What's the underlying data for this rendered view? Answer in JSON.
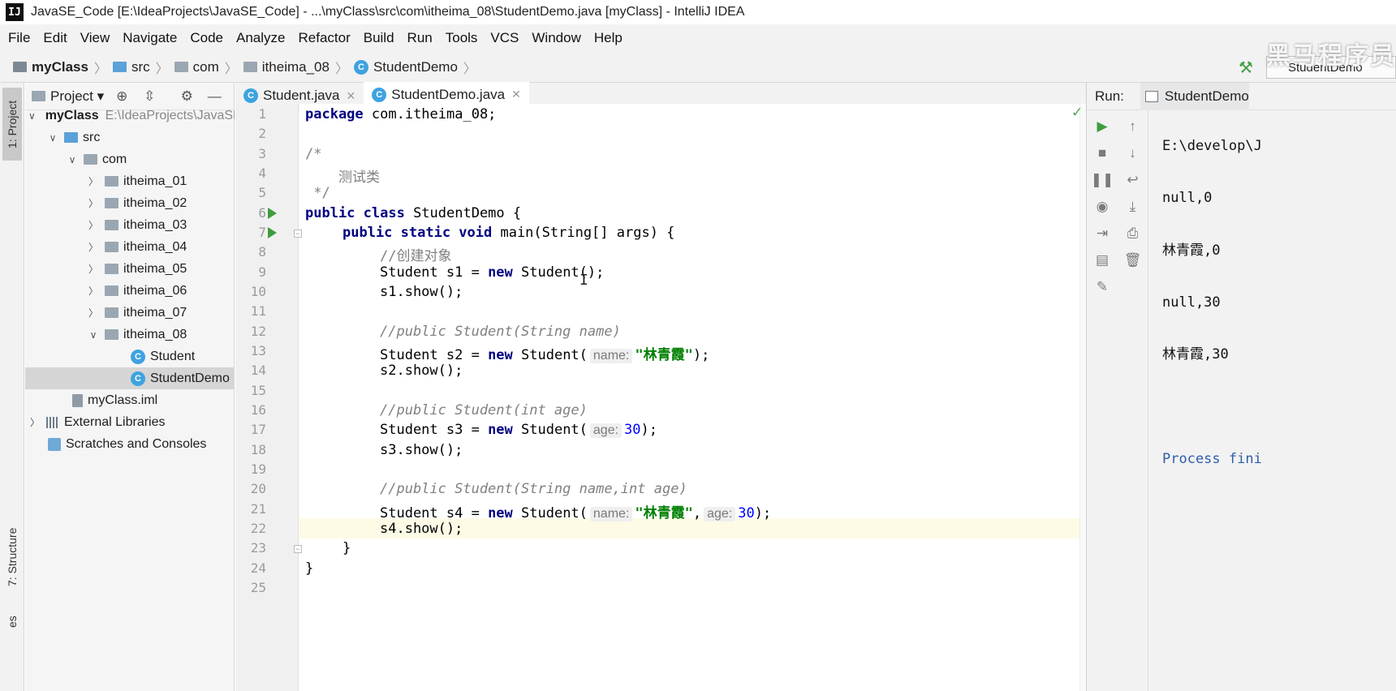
{
  "window": {
    "title": "JavaSE_Code [E:\\IdeaProjects\\JavaSE_Code] - ...\\myClass\\src\\com\\itheima_08\\StudentDemo.java [myClass] - IntelliJ IDEA",
    "app_icon": "IJ"
  },
  "menu": [
    "File",
    "Edit",
    "View",
    "Navigate",
    "Code",
    "Analyze",
    "Refactor",
    "Build",
    "Run",
    "Tools",
    "VCS",
    "Window",
    "Help"
  ],
  "breadcrumb": [
    "myClass",
    "src",
    "com",
    "itheima_08",
    "StudentDemo"
  ],
  "toolbar": {
    "run_config": "StudentDemo",
    "watermark": "黑马程序员"
  },
  "left_strip": {
    "project_tab": "1: Project",
    "structure_tab": "7: Structure",
    "favorites_tab": "es"
  },
  "project_panel": {
    "title": "Project",
    "tree": [
      {
        "label": "myClass",
        "path": "E:\\IdeaProjects\\JavaSE_Code\\myClass"
      },
      {
        "label": "src"
      },
      {
        "label": "com"
      },
      {
        "label": "itheima_01"
      },
      {
        "label": "itheima_02"
      },
      {
        "label": "itheima_03"
      },
      {
        "label": "itheima_04"
      },
      {
        "label": "itheima_05"
      },
      {
        "label": "itheima_06"
      },
      {
        "label": "itheima_07"
      },
      {
        "label": "itheima_08"
      },
      {
        "label": "Student"
      },
      {
        "label": "StudentDemo"
      },
      {
        "label": "myClass.iml"
      },
      {
        "label": "External Libraries"
      },
      {
        "label": "Scratches and Consoles"
      }
    ]
  },
  "editor": {
    "tabs": [
      "Student.java",
      "StudentDemo.java"
    ],
    "active_tab": "StudentDemo.java",
    "current_line": 22,
    "line_numbers": [
      "1",
      "2",
      "3",
      "4",
      "5",
      "6",
      "7",
      "8",
      "9",
      "10",
      "11",
      "12",
      "13",
      "14",
      "15",
      "16",
      "17",
      "18",
      "19",
      "20",
      "21",
      "22",
      "23",
      "24",
      "25"
    ],
    "code": {
      "l1_kw": "package",
      "l1_rest": " com.itheima_08;",
      "l3": "/*",
      "l4": "    测试类",
      "l5": " */",
      "l6_kw": "public class",
      "l6_rest": " StudentDemo {",
      "l7_kw": "public static void",
      "l7_rest": " main(String[] args) {",
      "l8": "//创建对象",
      "l9_a": "Student s1 = ",
      "l9_kw": "new",
      "l9_b": " Student();",
      "l10": "s1.show();",
      "l12": "//public Student(String name)",
      "l13_a": "Student s2 = ",
      "l13_kw": "new",
      "l13_b": " Student(",
      "l13_hint": "name:",
      "l13_str": "\"林青霞\"",
      "l13_c": ");",
      "l14": "s2.show();",
      "l16": "//public Student(int age)",
      "l17_a": "Student s3 = ",
      "l17_kw": "new",
      "l17_b": " Student(",
      "l17_hint": "age:",
      "l17_num": "30",
      "l17_c": ");",
      "l18": "s3.show();",
      "l20": "//public Student(String name,int age)",
      "l21_a": "Student s4 = ",
      "l21_kw": "new",
      "l21_b": " Student(",
      "l21_hint1": "name:",
      "l21_str": "\"林青霞\"",
      "l21_comma": ",",
      "l21_hint2": "age:",
      "l21_num": "30",
      "l21_c": ");",
      "l22": "s4.show();",
      "l23": "}",
      "l24": "}"
    }
  },
  "run_panel": {
    "label": "Run:",
    "tab": "StudentDemo",
    "output": [
      "E:\\develop\\J",
      "null,0",
      "林青霞,0",
      "null,30",
      "林青霞,30",
      "",
      "Process fini"
    ]
  },
  "colors": {
    "keyword": "#000080",
    "string": "#008000",
    "number": "#0000ff",
    "comment": "#808080",
    "run_green": "#3d9d3d",
    "class_icon": "#3ea3e0"
  }
}
